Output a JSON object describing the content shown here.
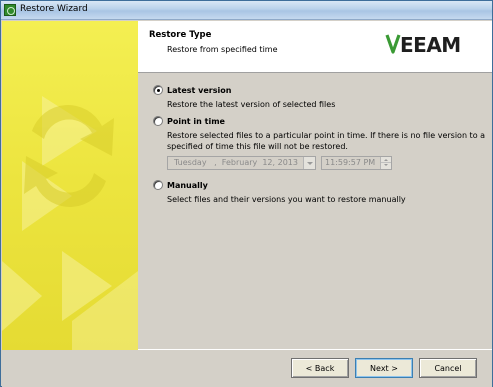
{
  "window": {
    "title": "Restore Wizard"
  },
  "header": {
    "title": "Restore Type",
    "subtitle": "Restore from specified time",
    "logo_text": "VEEAM"
  },
  "options": [
    {
      "label": "Latest version",
      "description": "Restore the latest version of selected files",
      "selected": true
    },
    {
      "label": "Point in time",
      "description_line1": "Restore selected files to a particular point in time. If there is no file version to a",
      "description_line2": "specified of time this file will not be restored.",
      "selected": false,
      "date_value": "Tuesday   ,  February  12, 2013",
      "time_value": "11:59:57 PM"
    },
    {
      "label": "Manually",
      "description": "Select files and their versions you want to restore manually",
      "selected": false
    }
  ],
  "buttons": {
    "back": "< Back",
    "next": "Next >",
    "cancel": "Cancel"
  },
  "colors": {
    "sidebar": "#ece43e",
    "brand_green": "#3a9a34",
    "window_bg": "#d4d0c8"
  }
}
